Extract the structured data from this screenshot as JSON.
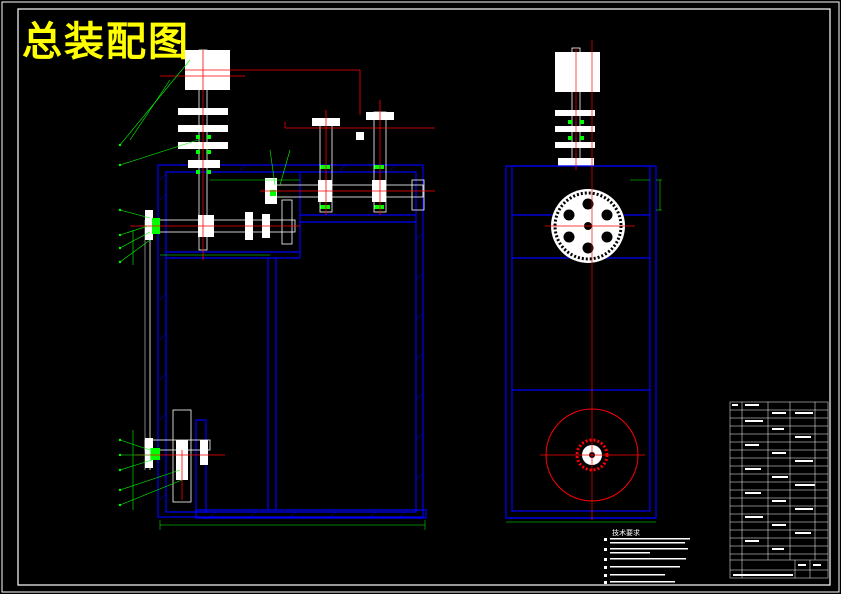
{
  "title": "总装配图",
  "tech_requirements": {
    "heading": "技术要求"
  },
  "colors": {
    "frame": "#ffffff",
    "outline": "#0000ff",
    "centerline": "#ff0000",
    "leader": "#00ff00",
    "title": "#ffff00",
    "part_fill": "#ffffff",
    "bearing": "#00ff00",
    "hatch": "#00ffff"
  },
  "icons": {
    "sprocket": "sprocket-gear",
    "pulley": "pulley-wheel",
    "bearing": "bearing-block"
  }
}
